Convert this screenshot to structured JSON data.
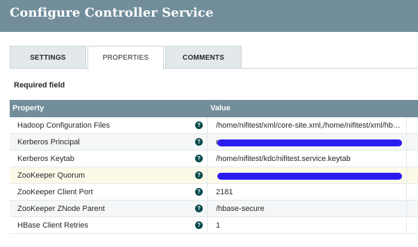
{
  "dialog": {
    "title": "Configure Controller Service"
  },
  "tabs": [
    {
      "label": "SETTINGS",
      "active": false
    },
    {
      "label": "PROPERTIES",
      "active": true
    },
    {
      "label": "COMMENTS",
      "active": false
    }
  ],
  "required_label": "Required field",
  "table": {
    "headers": {
      "property": "Property",
      "value": "Value"
    },
    "rows": [
      {
        "name": "Hadoop Configuration Files",
        "value": "/home/nifitest/xml/core-site.xml,/home/nifitest/xml/hbase-site.xml"
      },
      {
        "name": "Kerberos Principal",
        "value": "n"
      },
      {
        "name": "Kerberos Keytab",
        "value": "/home/nifitest/kdc/nifitest.service.keytab"
      },
      {
        "name": "ZooKeeper Quorum",
        "value": ""
      },
      {
        "name": "ZooKeeper Client Port",
        "value": "2181"
      },
      {
        "name": "ZooKeeper ZNode Parent",
        "value": "/hbase-secure"
      },
      {
        "name": "HBase Client Retries",
        "value": "1"
      }
    ]
  },
  "icons": {
    "help": "help-icon",
    "help_glyph": "?"
  },
  "colors": {
    "header_bg": "#728e9b",
    "help_icon": "#004849",
    "redaction": "#2a1cf0",
    "highlight_row": "#fcf9e8"
  }
}
